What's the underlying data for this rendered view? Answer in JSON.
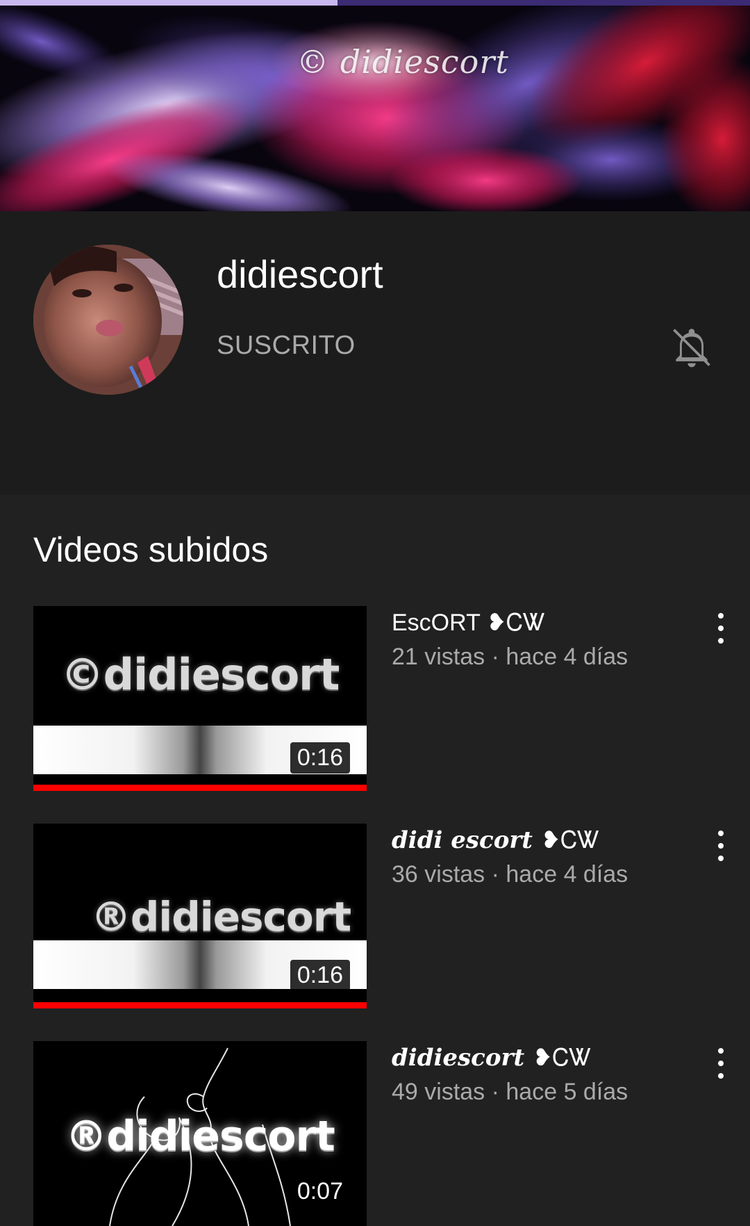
{
  "top_bar": {
    "progress": 0.45,
    "fill_color": "#c9b8ef",
    "track_color": "#3b2b74"
  },
  "banner": {
    "watermark": "© didiescort"
  },
  "channel": {
    "name": "didiescort",
    "subscribe_label": "SUSCRITO",
    "notifications_icon": "bell-off-icon"
  },
  "uploads": {
    "title": "Videos subidos",
    "videos": [
      {
        "title": "EscORT",
        "title_suffix": "❥ᏟᏔ",
        "meta": "21 vistas · hace 4 días",
        "thumb_text": "©didiescort",
        "duration": "0:16",
        "watched": 1.0
      },
      {
        "title": "didi escort",
        "title_suffix": "❥ᏟᏔ",
        "meta": "36 vistas · hace 4 días",
        "thumb_text": "®didiescort",
        "duration": "0:16",
        "watched": 1.0
      },
      {
        "title": "didiescort",
        "title_suffix": "❥ᏟᏔ",
        "meta": "49 vistas · hace 5 días",
        "thumb_text": "®didiescort",
        "duration": "0:07",
        "watched": 0
      }
    ]
  },
  "colors": {
    "background": "#212121",
    "header_background": "#1c1c1c",
    "text_secondary": "#aaaaaa",
    "progress_red": "#ff0000"
  }
}
